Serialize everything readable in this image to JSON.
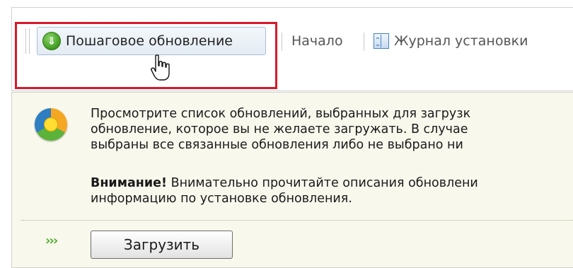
{
  "toolbar": {
    "step_update_label": "Пошаговое обновление",
    "home_label": "Начало",
    "journal_label": "Журнал установки"
  },
  "message": {
    "line1": "Просмотрите список обновлений, выбранных для загрузк",
    "line2": "обновление, которое вы не желаете загружать. В случае",
    "line3": "выбраны все связанные обновления либо не выбрано ни",
    "warning_title": "Внимание!",
    "line4_rest": "Внимательно прочитайте описания обновлени",
    "line5": "информацию по установке обновления."
  },
  "actions": {
    "download_label": "Загрузить"
  },
  "colors": {
    "highlight": "#d6192c",
    "panel_bg": "#f8f8ec",
    "arrow_green": "#4caf2a"
  }
}
